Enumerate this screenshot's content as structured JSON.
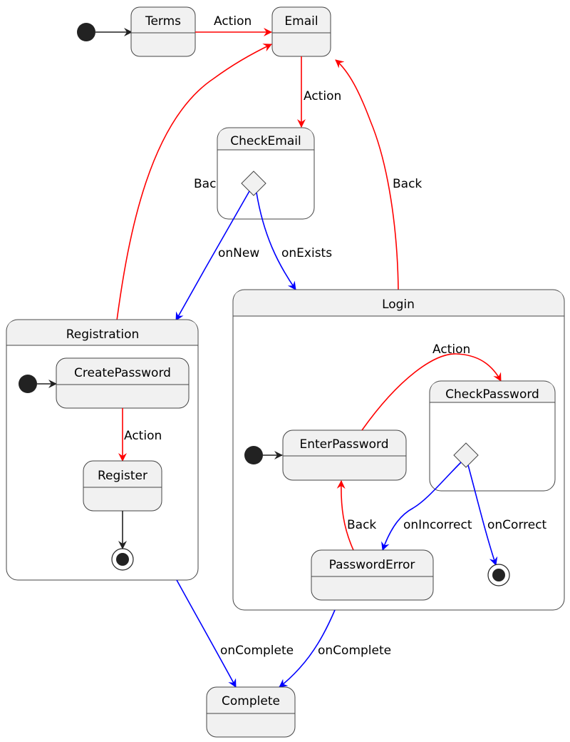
{
  "colors": {
    "action": "#ff0000",
    "event": "#0000ff",
    "default": "#222222",
    "state_fill": "#f1f1f1",
    "border": "#454545"
  },
  "states": {
    "terms": "Terms",
    "email": "Email",
    "check_email": "CheckEmail",
    "registration": "Registration",
    "create_password": "CreatePassword",
    "register": "Register",
    "login": "Login",
    "enter_password": "EnterPassword",
    "check_password": "CheckPassword",
    "password_error": "PasswordError",
    "complete": "Complete"
  },
  "transitions": {
    "terms_to_email": "Action",
    "email_to_check_email": "Action",
    "registration_to_email": "Back",
    "login_to_email": "Back",
    "check_email_on_new": "onNew",
    "check_email_on_exists": "onExists",
    "create_to_register": "Action",
    "enter_to_check_password": "Action",
    "password_error_back": "Back",
    "on_incorrect": "onIncorrect",
    "on_correct": "onCorrect",
    "registration_complete": "onComplete",
    "login_complete": "onComplete"
  }
}
